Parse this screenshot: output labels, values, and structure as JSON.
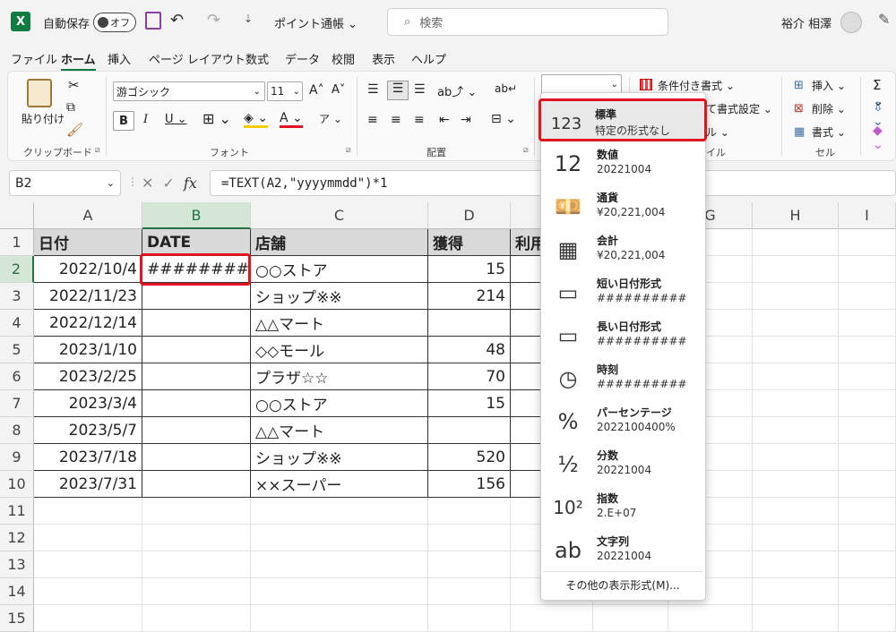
{
  "titlebar": {
    "autosave_label": "自動保存",
    "autosave_state": "オフ",
    "file_name": "ポイント通帳",
    "search_placeholder": "検索",
    "user_name": "裕介 相澤"
  },
  "menu_tabs": [
    "ファイル",
    "ホーム",
    "挿入",
    "ページ レイアウト",
    "数式",
    "データ",
    "校閲",
    "表示",
    "ヘルプ"
  ],
  "ribbon": {
    "paste_label": "貼り付け",
    "clipboard_group": "クリップボード",
    "font_name": "游ゴシック",
    "font_size": "11",
    "font_group": "フォント",
    "align_group": "配置",
    "number_format_value": "",
    "cond_format": "条件付き書式",
    "table_format": "て書式設定",
    "style_group": "イル",
    "insert_label": "挿入",
    "delete_label": "削除",
    "format_label": "書式",
    "cell_group": "セル"
  },
  "formula_bar": {
    "name_box": "B2",
    "formula": "=TEXT(A2,\"yyyymmdd\")*1"
  },
  "columns": [
    "A",
    "B",
    "C",
    "D",
    "E",
    "F",
    "G",
    "H",
    "I"
  ],
  "headers": [
    "日付",
    "DATE",
    "店舗",
    "獲得",
    "利用"
  ],
  "rows": [
    {
      "n": "1"
    },
    {
      "n": "2",
      "a": "2022/10/4",
      "b": "##########",
      "c": "○○ストア",
      "d": "15"
    },
    {
      "n": "3",
      "a": "2022/11/23",
      "b": "",
      "c": "ショップ※※",
      "d": "214"
    },
    {
      "n": "4",
      "a": "2022/12/14",
      "b": "",
      "c": "△△マート",
      "d": ""
    },
    {
      "n": "5",
      "a": "2023/1/10",
      "b": "",
      "c": "◇◇モール",
      "d": "48"
    },
    {
      "n": "6",
      "a": "2023/2/25",
      "b": "",
      "c": "プラザ☆☆",
      "d": "70"
    },
    {
      "n": "7",
      "a": "2023/3/4",
      "b": "",
      "c": "○○ストア",
      "d": "15"
    },
    {
      "n": "8",
      "a": "2023/5/7",
      "b": "",
      "c": "△△マート",
      "d": ""
    },
    {
      "n": "9",
      "a": "2023/7/18",
      "b": "",
      "c": "ショップ※※",
      "d": "520"
    },
    {
      "n": "10",
      "a": "2023/7/31",
      "b": "",
      "c": "××スーパー",
      "d": "156"
    },
    {
      "n": "11"
    },
    {
      "n": "12"
    },
    {
      "n": "13"
    },
    {
      "n": "14"
    },
    {
      "n": "15"
    }
  ],
  "number_format_menu": {
    "items": [
      {
        "name": "標準",
        "example": "特定の形式なし",
        "icon": "clock-123-icon",
        "glyph": "123"
      },
      {
        "name": "数値",
        "example": "20221004",
        "icon": "number-12-icon",
        "glyph": "12"
      },
      {
        "name": "通貨",
        "example": "¥20,221,004",
        "icon": "currency-icon",
        "glyph": "💴"
      },
      {
        "name": "会計",
        "example": "¥20,221,004",
        "icon": "accounting-calculator-icon",
        "glyph": "▦"
      },
      {
        "name": "短い日付形式",
        "example": "##########",
        "icon": "calendar-short-icon",
        "glyph": "▭"
      },
      {
        "name": "長い日付形式",
        "example": "##########",
        "icon": "calendar-long-icon",
        "glyph": "▭"
      },
      {
        "name": "時刻",
        "example": "##########",
        "icon": "clock-icon",
        "glyph": "◷"
      },
      {
        "name": "パーセンテージ",
        "example": "2022100400%",
        "icon": "percent-icon",
        "glyph": "%"
      },
      {
        "name": "分数",
        "example": "20221004",
        "icon": "fraction-icon",
        "glyph": "½"
      },
      {
        "name": "指数",
        "example": "2.E+07",
        "icon": "exponent-icon",
        "glyph": "10²"
      },
      {
        "name": "文字列",
        "example": "20221004",
        "icon": "text-ab-icon",
        "glyph": "ab"
      }
    ],
    "more_label": "その他の表示形式(M)..."
  },
  "colors": {
    "excel_green": "#107c41",
    "highlight_red": "#e0141e",
    "table_header": "#d9d9d9"
  }
}
